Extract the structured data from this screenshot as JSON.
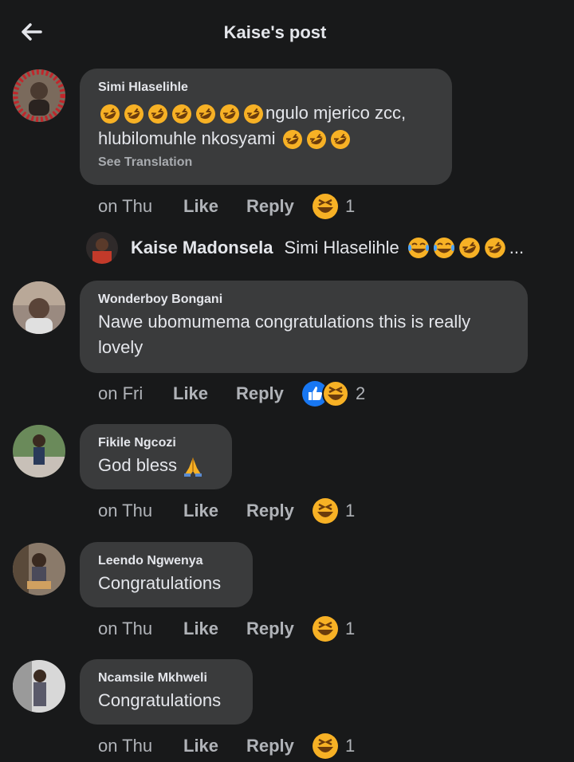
{
  "header": {
    "title": "Kaise's post",
    "back_icon": "back-arrow-icon"
  },
  "comments": [
    {
      "author": "Simi Hlaselihle",
      "text_line1": "ngulo mjerico zcc,",
      "text_line2": "hlubilomuhle nkosyami",
      "see_translation": "See Translation",
      "time": "on Thu",
      "like": "Like",
      "reply": "Reply",
      "reaction_count": "1",
      "reactions": [
        "laughing-emoji"
      ]
    },
    {
      "author": "Wonderboy Bongani",
      "text_line1": "Nawe ubomumema congratulations this is really",
      "text_line2": "lovely",
      "time": "on Fri",
      "like": "Like",
      "reply": "Reply",
      "reaction_count": "2",
      "reactions": [
        "like-emoji",
        "laughing-emoji"
      ]
    },
    {
      "author": "Fikile Ngcozi",
      "text_line1": "God bless",
      "time": "on Thu",
      "like": "Like",
      "reply": "Reply",
      "reaction_count": "1",
      "reactions": [
        "laughing-emoji"
      ]
    },
    {
      "author": "Leendo Ngwenya",
      "text_line1": "Congratulations",
      "time": "on Thu",
      "like": "Like",
      "reply": "Reply",
      "reaction_count": "1",
      "reactions": [
        "laughing-emoji"
      ]
    },
    {
      "author": "Ncamsile Mkhweli",
      "text_line1": "Congratulations",
      "time": "on Thu",
      "like": "Like",
      "reply": "Reply",
      "reaction_count": "1",
      "reactions": [
        "laughing-emoji"
      ]
    }
  ],
  "reply_preview": {
    "author": "Kaise Madonsela",
    "text": "Simi Hlaselihle",
    "ellipsis": "..."
  },
  "colors": {
    "background": "#18191a",
    "bubble": "#3a3b3c",
    "text": "#e4e6eb",
    "secondary": "#b0b3b8",
    "like_blue": "#1877f2",
    "emoji_yellow": "#f7b125"
  }
}
